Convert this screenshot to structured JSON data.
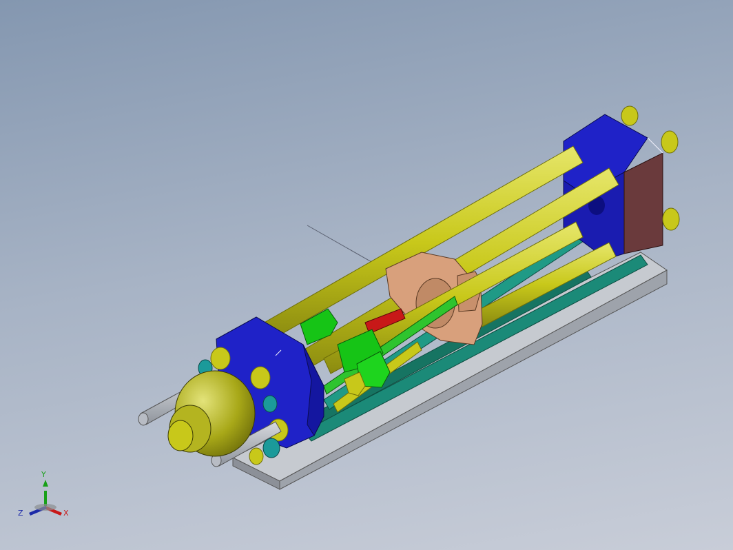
{
  "viewport": {
    "background_top": "#8497b0",
    "background_bottom": "#c8cdd8"
  },
  "model": {
    "parts": [
      {
        "name": "base-plate",
        "color": "#b8bcc4"
      },
      {
        "name": "end-plate",
        "color": "#1f22c8"
      },
      {
        "name": "tie-rod",
        "color": "#c8c81a"
      },
      {
        "name": "moving-platen",
        "color": "#d8a07c"
      },
      {
        "name": "guide-block",
        "color": "#16c416"
      },
      {
        "name": "guide-rail",
        "color": "#1b8a78"
      },
      {
        "name": "nozzle-head",
        "color": "#a8a818"
      },
      {
        "name": "rear-panel",
        "color": "#6a3a3c"
      },
      {
        "name": "screw-shaft",
        "color": "#c81818"
      },
      {
        "name": "support-rod",
        "color": "#a8acb4"
      }
    ]
  },
  "triad": {
    "labels": {
      "x": "X",
      "y": "Y",
      "z": "Z"
    },
    "colors": {
      "x": "#c81818",
      "y": "#18a018",
      "z": "#1c2aa8"
    }
  }
}
